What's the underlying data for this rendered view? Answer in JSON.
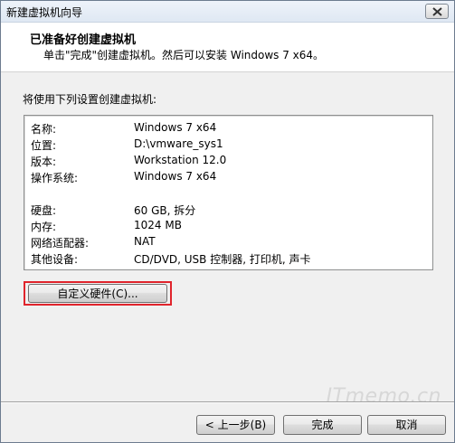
{
  "window": {
    "title": "新建虚拟机向导"
  },
  "header": {
    "title": "已准备好创建虚拟机",
    "subtitle": "单击\"完成\"创建虚拟机。然后可以安装 Windows 7 x64。"
  },
  "settings": {
    "label": "将使用下列设置创建虚拟机:",
    "rows": [
      {
        "key": "名称:",
        "value": "Windows 7 x64"
      },
      {
        "key": "位置:",
        "value": "D:\\vmware_sys1"
      },
      {
        "key": "版本:",
        "value": "Workstation 12.0"
      },
      {
        "key": "操作系统:",
        "value": "Windows 7 x64"
      },
      {
        "key": "硬盘:",
        "value": "60 GB, 拆分"
      },
      {
        "key": "内存:",
        "value": "1024 MB"
      },
      {
        "key": "网络适配器:",
        "value": "NAT"
      },
      {
        "key": "其他设备:",
        "value": "CD/DVD, USB 控制器, 打印机, 声卡"
      }
    ]
  },
  "buttons": {
    "customize_hardware": "自定义硬件(C)...",
    "back": "< 上一步(B)",
    "finish": "完成",
    "cancel": "取消"
  },
  "watermark": "ITmemo.cn",
  "colors": {
    "highlight_border": "#e0242c"
  }
}
